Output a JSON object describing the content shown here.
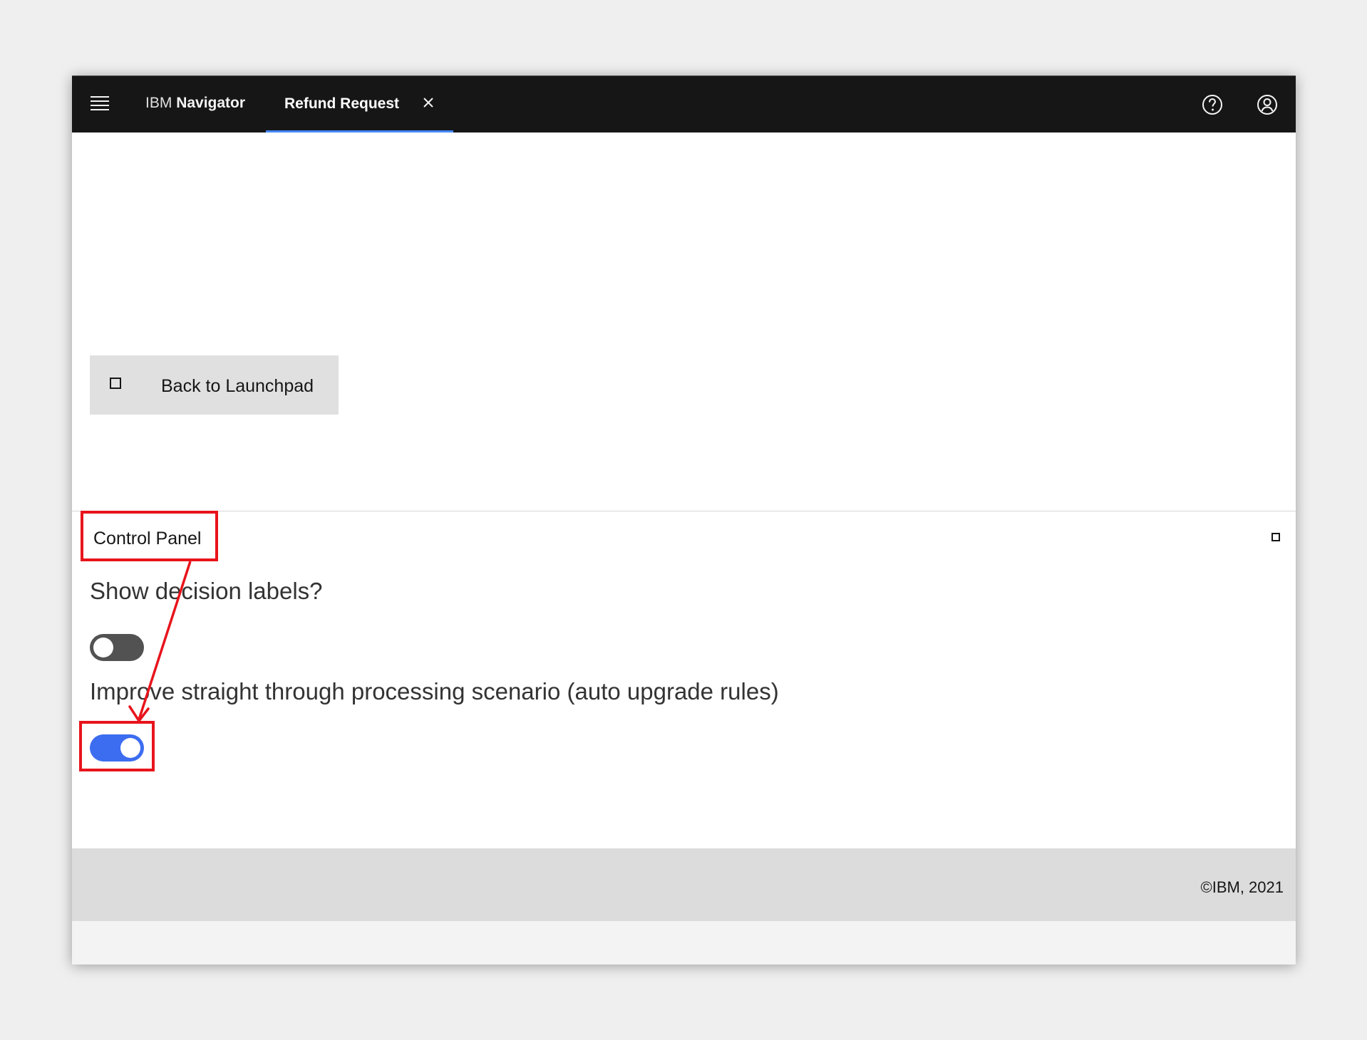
{
  "header": {
    "brand_prefix": "IBM",
    "brand_name": "Navigator",
    "menu_icon": "hamburger-menu-icon",
    "help_icon": "help-icon",
    "user_icon": "user-avatar-icon"
  },
  "tabs": [
    {
      "label": "Refund Request",
      "active": true,
      "close_icon": "close-icon"
    }
  ],
  "main": {
    "back_button_label": "Back to Launchpad"
  },
  "control_panel": {
    "title": "Control Panel",
    "questions": [
      {
        "label": "Show decision labels?",
        "toggle_on": false
      },
      {
        "label": "Improve straight through processing scenario (auto upgrade rules)",
        "toggle_on": true
      }
    ]
  },
  "footer": {
    "copyright": "©IBM, 2021"
  },
  "colors": {
    "header_bg": "#161616",
    "tab_indicator": "#4589ff",
    "toggle_on": "#3c6df0",
    "toggle_off": "#525252",
    "annotation": "#e8141c"
  }
}
